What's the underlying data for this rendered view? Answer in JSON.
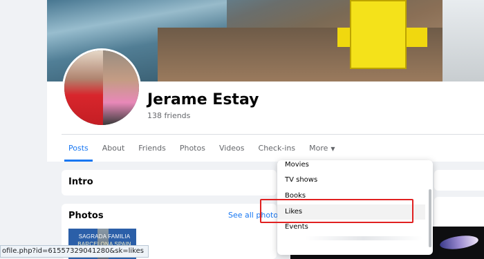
{
  "profile": {
    "name": "Jerame Estay",
    "friends": "138 friends"
  },
  "tabs": [
    {
      "label": "Posts",
      "active": true
    },
    {
      "label": "About"
    },
    {
      "label": "Friends"
    },
    {
      "label": "Photos"
    },
    {
      "label": "Videos"
    },
    {
      "label": "Check-ins"
    },
    {
      "label": "More",
      "caret": "▼"
    }
  ],
  "intro": {
    "title": "Intro"
  },
  "photos": {
    "title": "Photos",
    "see_all": "See all photos",
    "thumb_text_1": "SAGRADA FAMILIA",
    "thumb_text_2": "BARCELONA SPAIN"
  },
  "more_menu": {
    "items": [
      {
        "label": "Movies"
      },
      {
        "label": "TV shows"
      },
      {
        "label": "Books"
      },
      {
        "label": "Likes",
        "highlighted": true
      },
      {
        "label": "Events"
      }
    ]
  },
  "status_bar": {
    "url": "ofile.php?id=61557329041280&sk=likes"
  },
  "colors": {
    "accent": "#1877f2",
    "highlight_box": "#e02020"
  }
}
